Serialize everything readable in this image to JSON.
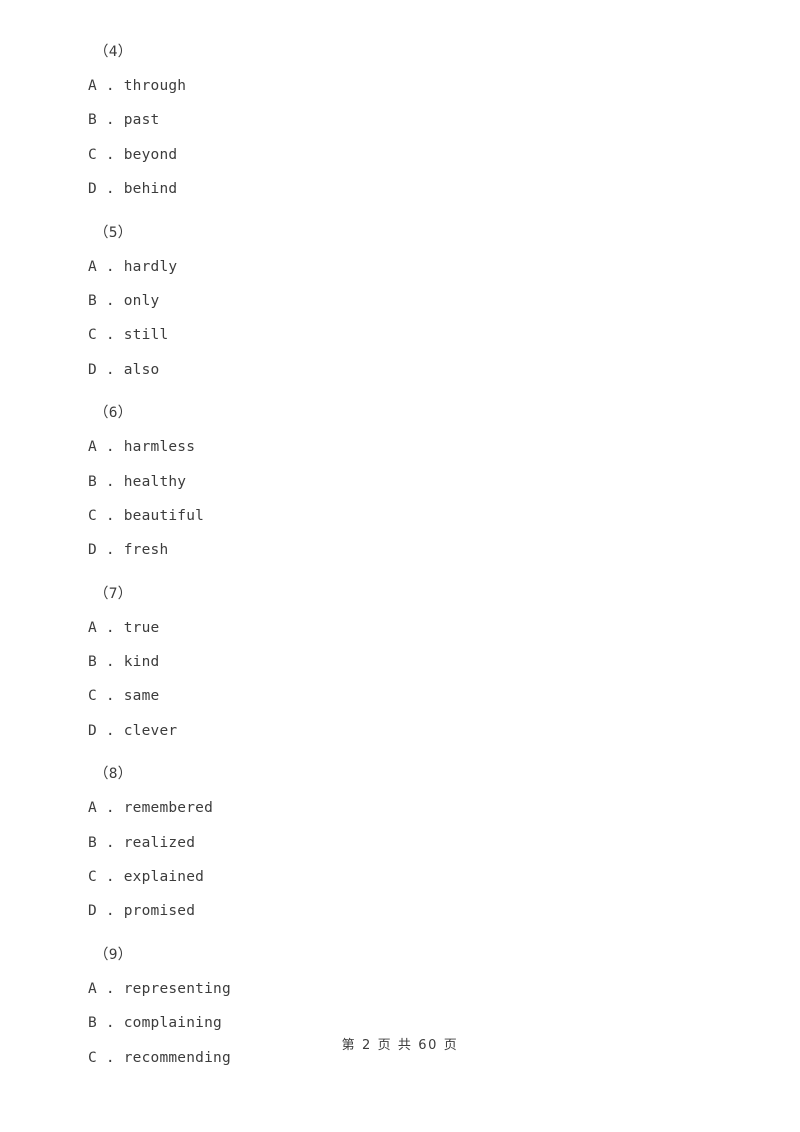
{
  "document": {
    "type": "exam-paper",
    "background_color": "#ffffff",
    "text_color": "#3c3c3c"
  },
  "questions": [
    {
      "number": "（4）",
      "options": [
        "A . through",
        "B . past",
        "C . beyond",
        "D . behind"
      ]
    },
    {
      "number": "（5）",
      "options": [
        "A . hardly",
        "B . only",
        "C . still",
        "D . also"
      ]
    },
    {
      "number": "（6）",
      "options": [
        "A . harmless",
        "B . healthy",
        "C . beautiful",
        "D . fresh"
      ]
    },
    {
      "number": "（7）",
      "options": [
        "A . true",
        "B . kind",
        "C . same",
        "D . clever"
      ]
    },
    {
      "number": "（8）",
      "options": [
        "A . remembered",
        "B . realized",
        "C . explained",
        "D . promised"
      ]
    },
    {
      "number": "（9）",
      "options": [
        "A . representing",
        "B . complaining",
        "C . recommending"
      ]
    }
  ],
  "footer": {
    "text": "第 2 页 共 60 页",
    "current_page": "2",
    "total_pages": "60"
  }
}
